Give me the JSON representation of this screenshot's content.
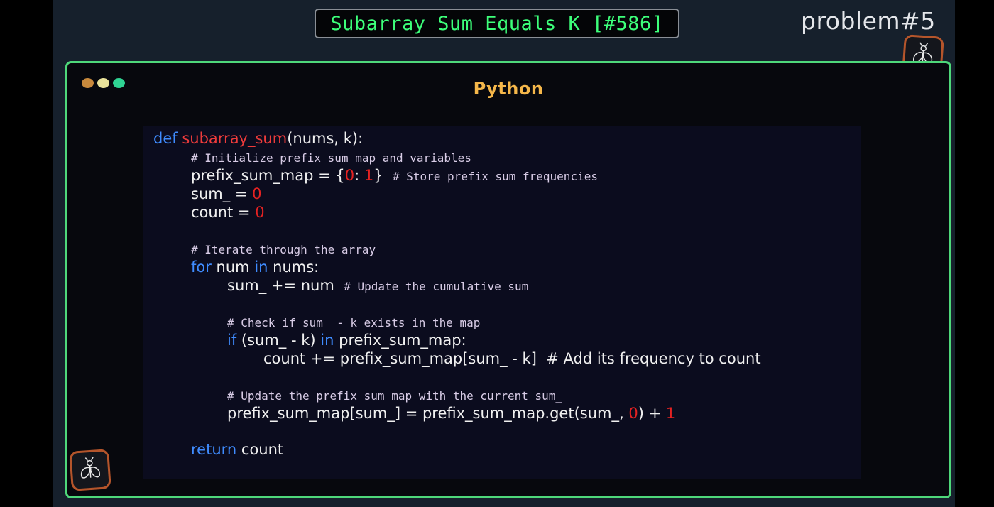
{
  "header": {
    "title": "Subarray Sum Equals K [#586]",
    "problem_label": "problem#5"
  },
  "logos": {
    "top": "bee-logo-icon",
    "bottom": "bee-logo-icon"
  },
  "window": {
    "language": "Python",
    "dots": [
      "#c8893c",
      "#e8e29a",
      "#2fd493"
    ]
  },
  "code": {
    "l1_kw": "def",
    "l1_fn": "subarray_sum",
    "l1_rest": "(nums, k):",
    "l2_comment": "# Initialize prefix sum map and variables",
    "l3_a": "prefix_sum_map = {",
    "l3_n1": "0",
    "l3_b": ": ",
    "l3_n2": "1",
    "l3_c": "}  ",
    "l3_comment": "# Store prefix sum frequencies",
    "l4_a": "sum_ = ",
    "l4_n": "0",
    "l5_a": "count = ",
    "l5_n": "0",
    "l6_comment": "# Iterate through the array",
    "l7_kw1": "for",
    "l7_a": " num ",
    "l7_kw2": "in",
    "l7_b": " nums:",
    "l8_a": "sum_ += num  ",
    "l8_comment": "# Update the cumulative sum",
    "l9_comment": "# Check if sum_ - k exists in the map",
    "l10_kw1": "if",
    "l10_a": " (sum_ - k) ",
    "l10_kw2": "in",
    "l10_b": " prefix_sum_map:",
    "l11_a": "count += prefix_sum_map[sum_ - k]  # Add its frequency to count",
    "l12_comment": "# Update the prefix sum map with the current sum_",
    "l13_a": "prefix_sum_map[sum_] = prefix_sum_map.get(sum_, ",
    "l13_n1": "0",
    "l13_b": ") + ",
    "l13_n2": "1",
    "l14_kw": "return",
    "l14_a": " count"
  }
}
